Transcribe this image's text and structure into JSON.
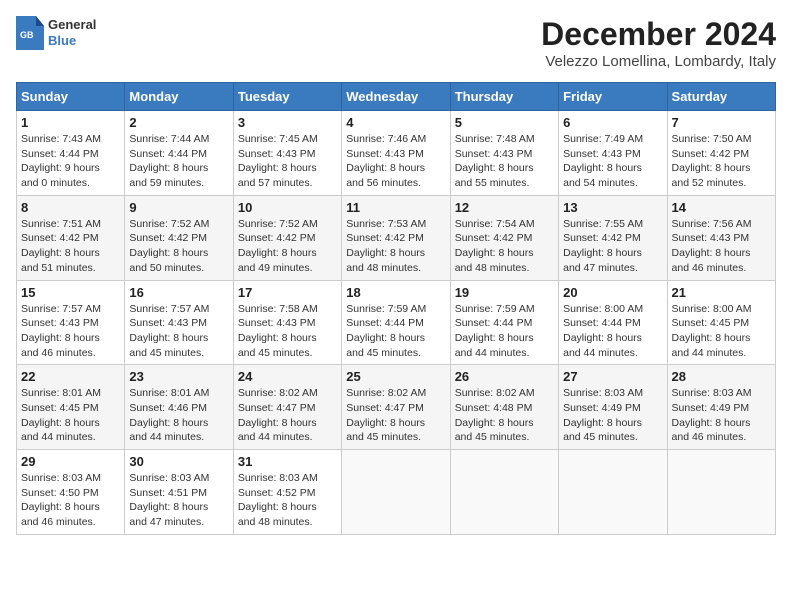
{
  "header": {
    "logo_line1": "General",
    "logo_line2": "Blue",
    "title": "December 2024",
    "subtitle": "Velezzo Lomellina, Lombardy, Italy"
  },
  "columns": [
    "Sunday",
    "Monday",
    "Tuesday",
    "Wednesday",
    "Thursday",
    "Friday",
    "Saturday"
  ],
  "weeks": [
    [
      {
        "day": "1",
        "detail": "Sunrise: 7:43 AM\nSunset: 4:44 PM\nDaylight: 9 hours\nand 0 minutes."
      },
      {
        "day": "2",
        "detail": "Sunrise: 7:44 AM\nSunset: 4:44 PM\nDaylight: 8 hours\nand 59 minutes."
      },
      {
        "day": "3",
        "detail": "Sunrise: 7:45 AM\nSunset: 4:43 PM\nDaylight: 8 hours\nand 57 minutes."
      },
      {
        "day": "4",
        "detail": "Sunrise: 7:46 AM\nSunset: 4:43 PM\nDaylight: 8 hours\nand 56 minutes."
      },
      {
        "day": "5",
        "detail": "Sunrise: 7:48 AM\nSunset: 4:43 PM\nDaylight: 8 hours\nand 55 minutes."
      },
      {
        "day": "6",
        "detail": "Sunrise: 7:49 AM\nSunset: 4:43 PM\nDaylight: 8 hours\nand 54 minutes."
      },
      {
        "day": "7",
        "detail": "Sunrise: 7:50 AM\nSunset: 4:42 PM\nDaylight: 8 hours\nand 52 minutes."
      }
    ],
    [
      {
        "day": "8",
        "detail": "Sunrise: 7:51 AM\nSunset: 4:42 PM\nDaylight: 8 hours\nand 51 minutes."
      },
      {
        "day": "9",
        "detail": "Sunrise: 7:52 AM\nSunset: 4:42 PM\nDaylight: 8 hours\nand 50 minutes."
      },
      {
        "day": "10",
        "detail": "Sunrise: 7:52 AM\nSunset: 4:42 PM\nDaylight: 8 hours\nand 49 minutes."
      },
      {
        "day": "11",
        "detail": "Sunrise: 7:53 AM\nSunset: 4:42 PM\nDaylight: 8 hours\nand 48 minutes."
      },
      {
        "day": "12",
        "detail": "Sunrise: 7:54 AM\nSunset: 4:42 PM\nDaylight: 8 hours\nand 48 minutes."
      },
      {
        "day": "13",
        "detail": "Sunrise: 7:55 AM\nSunset: 4:42 PM\nDaylight: 8 hours\nand 47 minutes."
      },
      {
        "day": "14",
        "detail": "Sunrise: 7:56 AM\nSunset: 4:43 PM\nDaylight: 8 hours\nand 46 minutes."
      }
    ],
    [
      {
        "day": "15",
        "detail": "Sunrise: 7:57 AM\nSunset: 4:43 PM\nDaylight: 8 hours\nand 46 minutes."
      },
      {
        "day": "16",
        "detail": "Sunrise: 7:57 AM\nSunset: 4:43 PM\nDaylight: 8 hours\nand 45 minutes."
      },
      {
        "day": "17",
        "detail": "Sunrise: 7:58 AM\nSunset: 4:43 PM\nDaylight: 8 hours\nand 45 minutes."
      },
      {
        "day": "18",
        "detail": "Sunrise: 7:59 AM\nSunset: 4:44 PM\nDaylight: 8 hours\nand 45 minutes."
      },
      {
        "day": "19",
        "detail": "Sunrise: 7:59 AM\nSunset: 4:44 PM\nDaylight: 8 hours\nand 44 minutes."
      },
      {
        "day": "20",
        "detail": "Sunrise: 8:00 AM\nSunset: 4:44 PM\nDaylight: 8 hours\nand 44 minutes."
      },
      {
        "day": "21",
        "detail": "Sunrise: 8:00 AM\nSunset: 4:45 PM\nDaylight: 8 hours\nand 44 minutes."
      }
    ],
    [
      {
        "day": "22",
        "detail": "Sunrise: 8:01 AM\nSunset: 4:45 PM\nDaylight: 8 hours\nand 44 minutes."
      },
      {
        "day": "23",
        "detail": "Sunrise: 8:01 AM\nSunset: 4:46 PM\nDaylight: 8 hours\nand 44 minutes."
      },
      {
        "day": "24",
        "detail": "Sunrise: 8:02 AM\nSunset: 4:47 PM\nDaylight: 8 hours\nand 44 minutes."
      },
      {
        "day": "25",
        "detail": "Sunrise: 8:02 AM\nSunset: 4:47 PM\nDaylight: 8 hours\nand 45 minutes."
      },
      {
        "day": "26",
        "detail": "Sunrise: 8:02 AM\nSunset: 4:48 PM\nDaylight: 8 hours\nand 45 minutes."
      },
      {
        "day": "27",
        "detail": "Sunrise: 8:03 AM\nSunset: 4:49 PM\nDaylight: 8 hours\nand 45 minutes."
      },
      {
        "day": "28",
        "detail": "Sunrise: 8:03 AM\nSunset: 4:49 PM\nDaylight: 8 hours\nand 46 minutes."
      }
    ],
    [
      {
        "day": "29",
        "detail": "Sunrise: 8:03 AM\nSunset: 4:50 PM\nDaylight: 8 hours\nand 46 minutes."
      },
      {
        "day": "30",
        "detail": "Sunrise: 8:03 AM\nSunset: 4:51 PM\nDaylight: 8 hours\nand 47 minutes."
      },
      {
        "day": "31",
        "detail": "Sunrise: 8:03 AM\nSunset: 4:52 PM\nDaylight: 8 hours\nand 48 minutes."
      },
      null,
      null,
      null,
      null
    ]
  ]
}
